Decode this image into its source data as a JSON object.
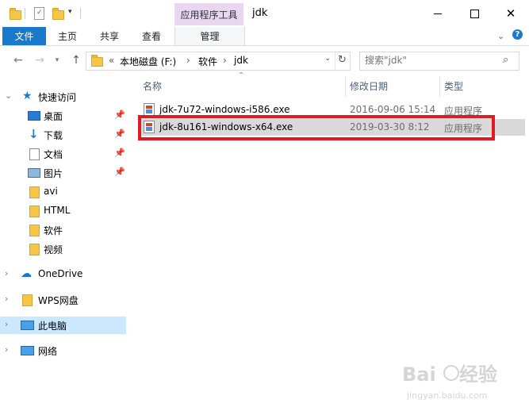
{
  "window": {
    "title": "jdk",
    "context_tab_title": "应用程序工具"
  },
  "ribbon": {
    "tabs": [
      "文件",
      "主页",
      "共享",
      "查看",
      "管理"
    ]
  },
  "address": {
    "prefix": "«",
    "path": [
      "本地磁盘 (F:)",
      "软件",
      "jdk"
    ],
    "separator": "›",
    "search_placeholder": "搜索\"jdk\""
  },
  "sidebar": {
    "quick_access": "快速访问",
    "items": [
      {
        "label": "桌面",
        "icon": "desktop-icon",
        "pinned": true
      },
      {
        "label": "下载",
        "icon": "download-icon",
        "pinned": true
      },
      {
        "label": "文档",
        "icon": "document-icon",
        "pinned": true
      },
      {
        "label": "图片",
        "icon": "picture-icon",
        "pinned": true
      },
      {
        "label": "avi",
        "icon": "folder-icon",
        "pinned": false
      },
      {
        "label": "HTML",
        "icon": "folder-icon",
        "pinned": false
      },
      {
        "label": "软件",
        "icon": "folder-icon",
        "pinned": false
      },
      {
        "label": "视频",
        "icon": "folder-icon",
        "pinned": false
      }
    ],
    "onedrive": "OneDrive",
    "wps": "WPS网盘",
    "this_pc": "此电脑",
    "network": "网络"
  },
  "columns": {
    "name": "名称",
    "date": "修改日期",
    "type": "类型"
  },
  "files": [
    {
      "name": "jdk-7u72-windows-i586.exe",
      "date": "2016-09-06 15:14",
      "type": "应用程序",
      "selected": false
    },
    {
      "name": "jdk-8u161-windows-x64.exe",
      "date": "2019-03-30 8:12",
      "type": "应用程序",
      "selected": true
    }
  ],
  "colors": {
    "accent": "#1979ca",
    "highlight": "#e01b22",
    "selection": "#d9d9d9",
    "context_tab": "#e9d7f2"
  },
  "watermark": {
    "brand": "Baidu",
    "product": "经验",
    "url": "jingyan.baidu.com"
  }
}
